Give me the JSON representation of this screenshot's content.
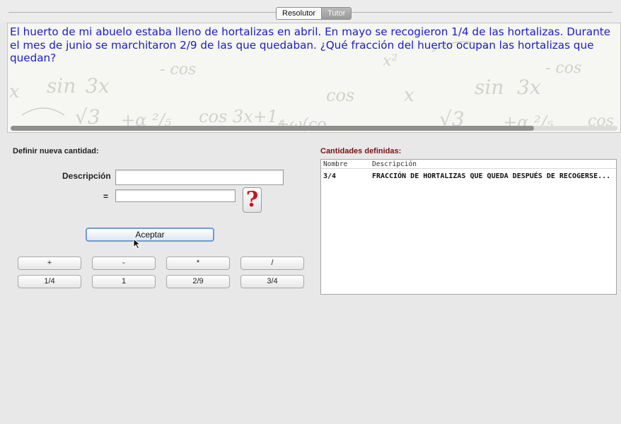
{
  "tabs": [
    {
      "label": "Resolutor",
      "active": false
    },
    {
      "label": "Tutor",
      "active": true
    }
  ],
  "problem": {
    "text": "El huerto de mi abuelo estaba lleno de hortalizas en abril. En mayo se recogieron 1/4 de las hortalizas. Durante el mes de junio se marchitaron 2/9 de las que quedaban. ¿Qué fracción del huerto ocupan las hortalizas que quedan?",
    "color": "#1c1cc8"
  },
  "define": {
    "title": "Definir nueva cantidad:",
    "description_label": "Descripción",
    "description_value": "",
    "equals_label": "=",
    "value": "",
    "help_symbol": "?",
    "accept_label": "Aceptar"
  },
  "calculator": {
    "operators": [
      "+",
      "-",
      "*",
      "/"
    ],
    "quantities": [
      "1/4",
      "1",
      "2/9",
      "3/4"
    ]
  },
  "defined": {
    "title": "Cantidades definidas:",
    "columns": [
      "Nombre",
      "Descripción"
    ],
    "rows": [
      {
        "name": "3/4",
        "description": "FRACCIÓN DE HORTALIZAS QUE QUEDA DESPUÉS DE RECOGERSE..."
      }
    ]
  },
  "colors": {
    "title_red": "#7a1010",
    "help_red": "#c8141e",
    "focus_blue": "#6d9bd6"
  }
}
